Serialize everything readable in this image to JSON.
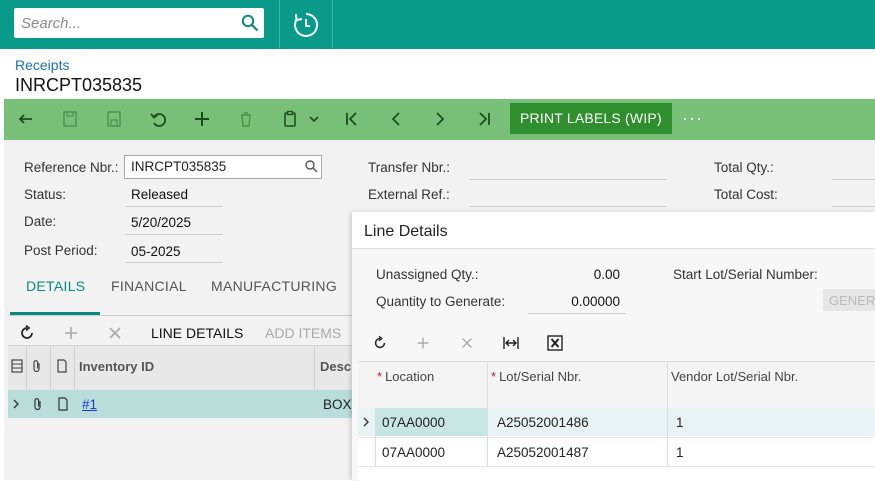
{
  "search": {
    "placeholder": "Search..."
  },
  "breadcrumb": "Receipts",
  "page_title": "INRCPT035835",
  "toolbar": {
    "print_labels": "PRINT LABELS (WIP)",
    "more": "···"
  },
  "form": {
    "reference_label": "Reference Nbr.:",
    "reference_value": "INRCPT035835",
    "status_label": "Status:",
    "status_value": "Released",
    "date_label": "Date:",
    "date_value": "5/20/2025",
    "post_period_label": "Post Period:",
    "post_period_value": "05-2025",
    "transfer_label": "Transfer Nbr.:",
    "external_ref_label": "External Ref.:",
    "total_qty_label": "Total Qty.:",
    "total_cost_label": "Total Cost:"
  },
  "tabs": [
    "DETAILS",
    "FINANCIAL",
    "MANUFACTURING"
  ],
  "grid_toolbar": {
    "line_details": "LINE DETAILS",
    "add_items": "ADD ITEMS"
  },
  "grid": {
    "columns": [
      "Inventory ID",
      "Descri"
    ],
    "rows": [
      {
        "inventory_id": "#1",
        "description": "BOX,"
      }
    ]
  },
  "dialog": {
    "title": "Line Details",
    "unassigned_label": "Unassigned Qty.:",
    "unassigned_value": "0.00",
    "qty_generate_label": "Quantity to Generate:",
    "qty_generate_value": "0.00000",
    "start_lot_label": "Start Lot/Serial Number:",
    "generate_button": "GENER",
    "columns": [
      "Location",
      "Lot/Serial Nbr.",
      "Vendor Lot/Serial Nbr."
    ],
    "rows": [
      {
        "location": "07AA0000",
        "lot": "A25052001486",
        "vendor_lot": "1"
      },
      {
        "location": "07AA0000",
        "lot": "A25052001487",
        "vendor_lot": "1"
      }
    ]
  }
}
